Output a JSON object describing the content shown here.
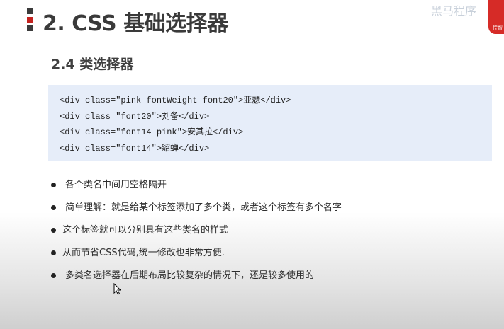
{
  "slide": {
    "title": "2. CSS 基础选择器",
    "subtitle": "2.4 类选择器"
  },
  "brand": {
    "text": "黑马程序",
    "sub": "传智"
  },
  "code": [
    "<div class=\"pink fontWeight font20\">亚瑟</div>",
    "<div class=\"font20\">刘备</div>",
    "<div class=\"font14 pink\">安其拉</div>",
    "<div class=\"font14\">貂蝉</div>"
  ],
  "bullets": [
    "各个类名中间用空格隔开",
    "简单理解：就是给某个标签添加了多个类，或者这个标签有多个名字",
    "这个标签就可以分别具有这些类名的样式",
    "从而节省CSS代码,统一修改也非常方便.",
    "多类名选择器在后期布局比较复杂的情况下，还是较多使用的"
  ],
  "colors": {
    "accent_red": "#c4221f",
    "code_bg": "#e6edf9",
    "title_text": "#3a3a3a"
  },
  "icons": {
    "cursor": "arrow-cursor-icon"
  }
}
